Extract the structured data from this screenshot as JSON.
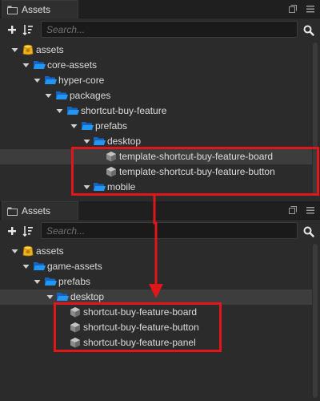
{
  "panel_top": {
    "tab_title": "Assets",
    "search_placeholder": "Search...",
    "tree": [
      {
        "label": "assets"
      },
      {
        "label": "core-assets"
      },
      {
        "label": "hyper-core"
      },
      {
        "label": "packages"
      },
      {
        "label": "shortcut-buy-feature"
      },
      {
        "label": "prefabs"
      },
      {
        "label": "desktop"
      },
      {
        "label": "template-shortcut-buy-feature-board"
      },
      {
        "label": "template-shortcut-buy-feature-button"
      },
      {
        "label": "mobile"
      }
    ]
  },
  "panel_bottom": {
    "tab_title": "Assets",
    "search_placeholder": "Search...",
    "tree": [
      {
        "label": "assets"
      },
      {
        "label": "game-assets"
      },
      {
        "label": "prefabs"
      },
      {
        "label": "desktop"
      },
      {
        "label": "shortcut-buy-feature-board"
      },
      {
        "label": "shortcut-buy-feature-button"
      },
      {
        "label": "shortcut-buy-feature-panel"
      }
    ]
  },
  "colors": {
    "highlight": "#e0161b",
    "folder": "#1e88e5",
    "db_icon": "#f0b21a",
    "selected_row": "#3d3d3d"
  }
}
